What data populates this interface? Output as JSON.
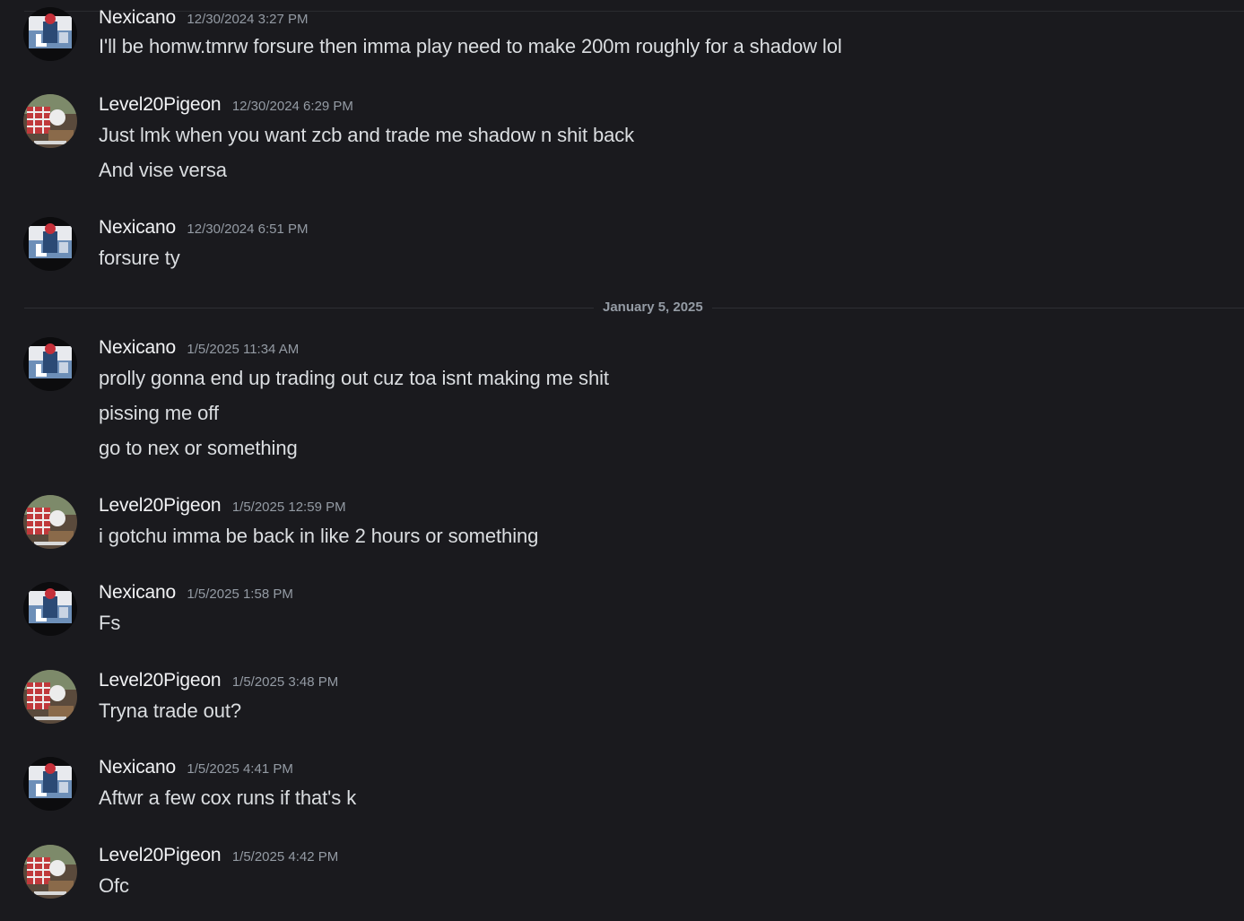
{
  "users": {
    "nexicano": "Nexicano",
    "pigeon": "Level20Pigeon"
  },
  "divider": {
    "label": "January 5, 2025"
  },
  "messages": [
    {
      "user": "Nexicano",
      "time": "12/30/2024 3:27 PM",
      "lines": [
        "I'll be homw.tmrw forsure then imma play need to make 200m roughly for a shadow lol"
      ]
    },
    {
      "user": "Level20Pigeon",
      "time": "12/30/2024 6:29 PM",
      "lines": [
        "Just lmk when you want zcb and trade me shadow n shit back",
        "And vise versa"
      ]
    },
    {
      "user": "Nexicano",
      "time": "12/30/2024 6:51 PM",
      "lines": [
        "forsure ty"
      ]
    },
    {
      "user": "Nexicano",
      "time": "1/5/2025 11:34 AM",
      "lines": [
        "prolly gonna end up trading out cuz toa isnt making me shit",
        "pissing me off",
        "go to nex or something"
      ]
    },
    {
      "user": "Level20Pigeon",
      "time": "1/5/2025 12:59 PM",
      "lines": [
        "i gotchu imma be back in like 2 hours or something"
      ]
    },
    {
      "user": "Nexicano",
      "time": "1/5/2025 1:58 PM",
      "lines": [
        "Fs"
      ]
    },
    {
      "user": "Level20Pigeon",
      "time": "1/5/2025 3:48 PM",
      "lines": [
        "Tryna trade out?"
      ]
    },
    {
      "user": "Nexicano",
      "time": "1/5/2025 4:41 PM",
      "lines": [
        "Aftwr a few cox runs if that's k"
      ]
    },
    {
      "user": "Level20Pigeon",
      "time": "1/5/2025 4:42 PM",
      "lines": [
        "Ofc"
      ]
    }
  ],
  "colors": {
    "background": "#1a1a1e",
    "username": "#f2f3f5",
    "timestamp": "#949ba4",
    "text": "#dbdee1"
  }
}
